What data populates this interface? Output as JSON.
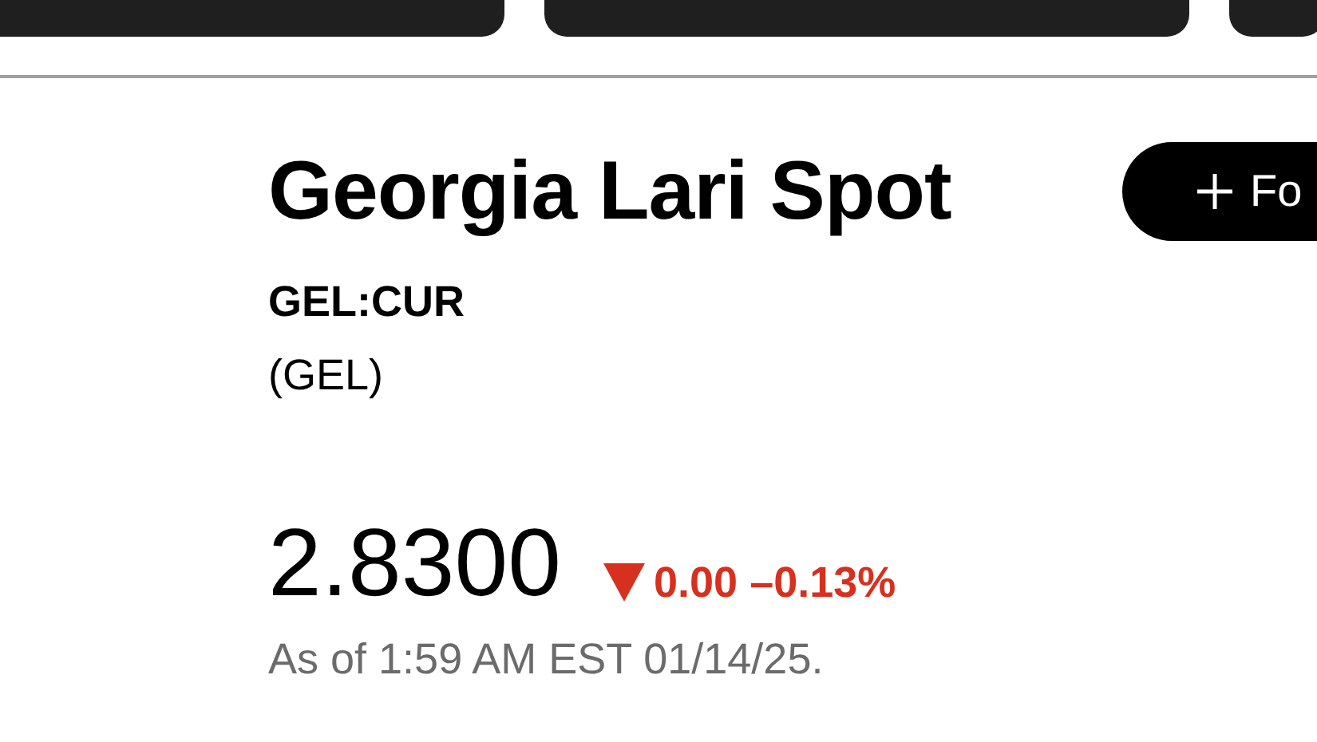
{
  "ticker_cards": [
    {
      "kind": "card"
    },
    {
      "kind": "card"
    },
    {
      "kind": "card"
    }
  ],
  "title": "Georgia Lari Spot",
  "follow_button": {
    "label": "Fo"
  },
  "symbol": "GEL:CUR",
  "currency": "(GEL)",
  "price": "2.8300",
  "change": {
    "falling": true,
    "text": "0.00 –0.13%"
  },
  "timestamp": "As of 1:59 AM EST 01/14/25."
}
